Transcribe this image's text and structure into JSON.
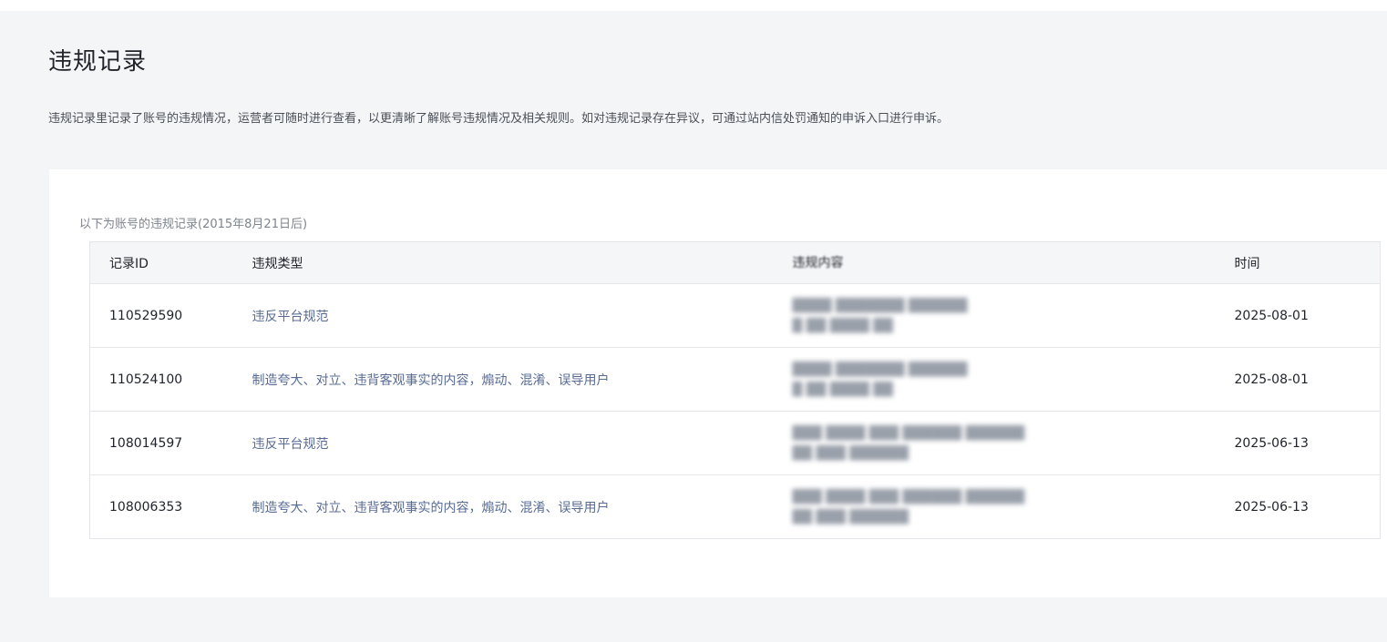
{
  "page": {
    "title": "违规记录",
    "description": "违规记录里记录了账号的违规情况，运营者可随时进行查看，以更清晰了解账号违规情况及相关规则。如对违规记录存在异议，可通过站内信处罚通知的申诉入口进行申诉。"
  },
  "table": {
    "caption": "以下为账号的违规记录(2015年8月21日后)",
    "headers": {
      "id": "记录ID",
      "type": "违规类型",
      "content": "违规内容",
      "time": "时间"
    },
    "rows": [
      {
        "id": "110529590",
        "type": "违反平台规范",
        "time": "2025-08-01"
      },
      {
        "id": "110524100",
        "type": "制造夸大、对立、违背客观事实的内容，煽动、混淆、误导用户",
        "time": "2025-08-01"
      },
      {
        "id": "108014597",
        "type": "违反平台规范",
        "time": "2025-06-13"
      },
      {
        "id": "108006353",
        "type": "制造夸大、对立、违背客观事实的内容，煽动、混淆、误导用户",
        "time": "2025-06-13"
      }
    ]
  },
  "colors": {
    "link": "#576b95",
    "background": "#f4f5f7",
    "card": "#ffffff",
    "header_row": "#f5f6f8"
  }
}
